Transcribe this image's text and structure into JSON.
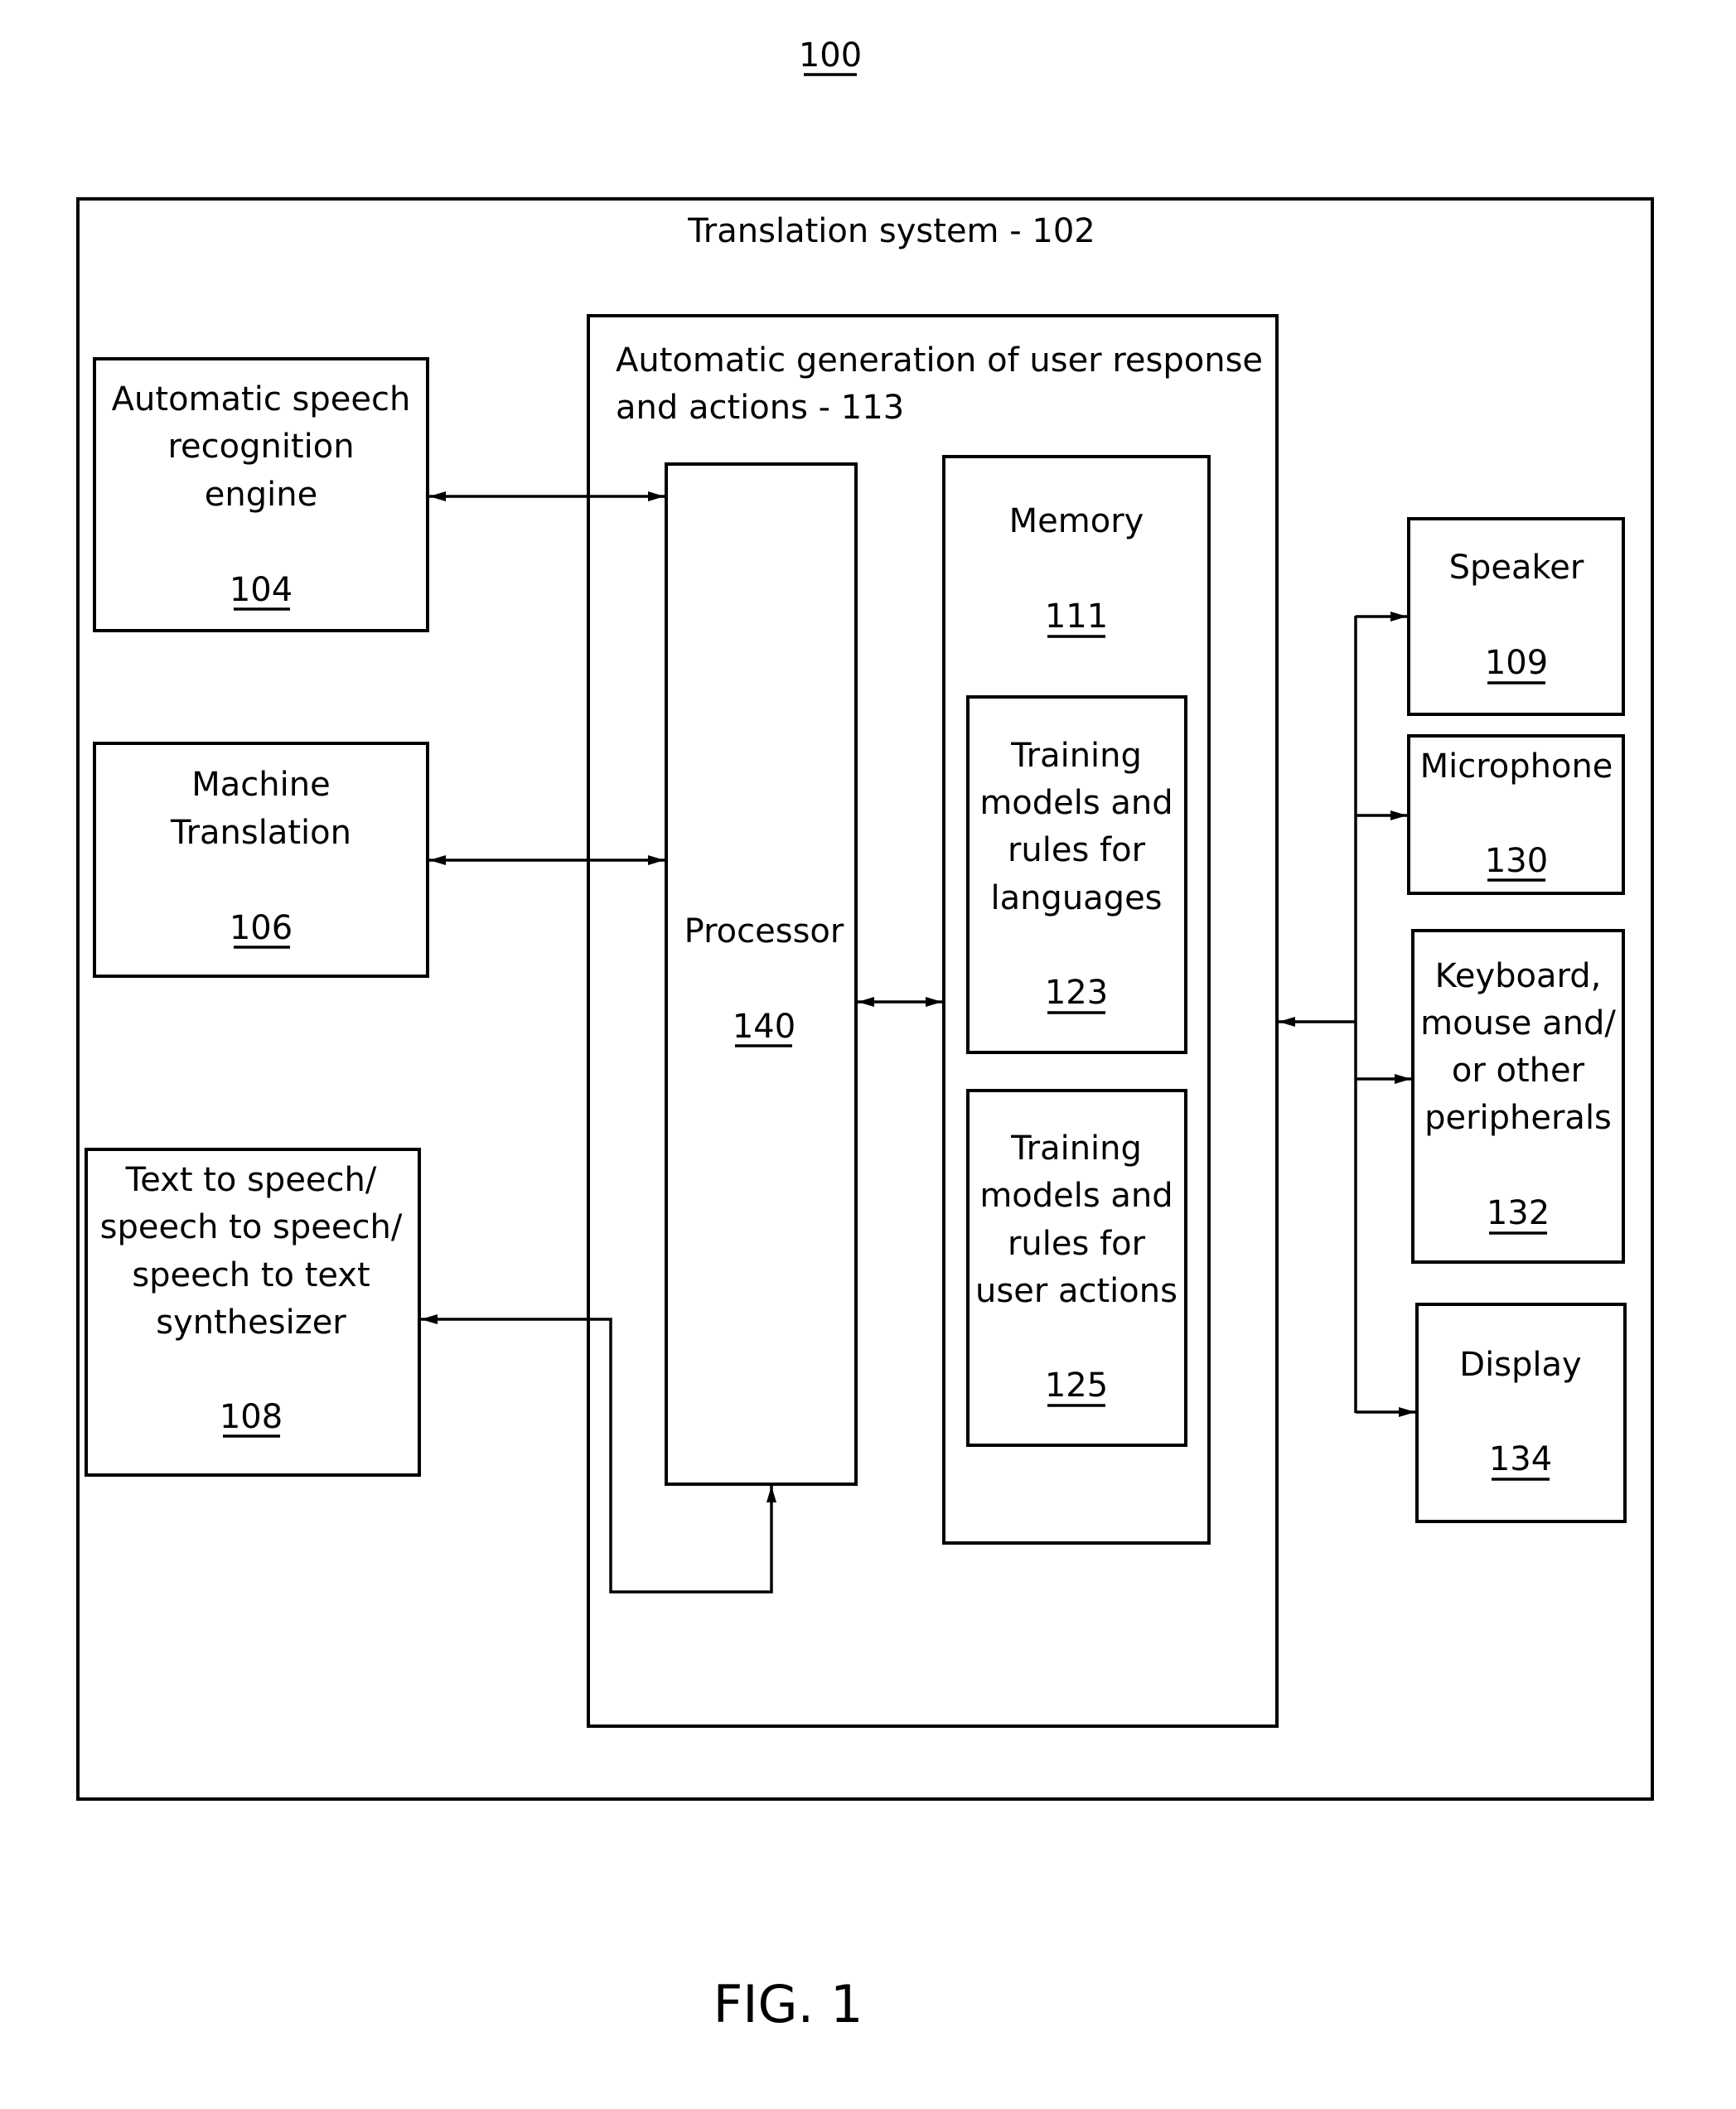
{
  "figure": {
    "reference": "100",
    "caption": "FIG. 1"
  },
  "system": {
    "title": "Translation system - 102"
  },
  "generator": {
    "title_line1": "Automatic generation of user response",
    "title_line2": "and actions  -  113"
  },
  "blocks": {
    "asr": {
      "lines": [
        "Automatic speech",
        "recognition",
        "engine"
      ],
      "ref": "104"
    },
    "mt": {
      "lines": [
        "Machine",
        "Translation"
      ],
      "ref": "106"
    },
    "tts": {
      "lines": [
        "Text to speech/",
        "speech to speech/",
        "speech to text",
        "synthesizer"
      ],
      "ref": "108"
    },
    "processor": {
      "lines": [
        "Processor"
      ],
      "ref": "140"
    },
    "memory": {
      "lines": [
        "Memory"
      ],
      "ref": "111"
    },
    "lang_models": {
      "lines": [
        "Training",
        "models and",
        "rules for",
        "languages"
      ],
      "ref": "123"
    },
    "action_models": {
      "lines": [
        "Training",
        "models and",
        "rules for",
        "user actions"
      ],
      "ref": "125"
    },
    "speaker": {
      "lines": [
        "Speaker"
      ],
      "ref": "109"
    },
    "microphone": {
      "lines": [
        "Microphone"
      ],
      "ref": "130"
    },
    "peripherals": {
      "lines": [
        "Keyboard,",
        "mouse and/",
        "or other",
        "peripherals"
      ],
      "ref": "132"
    },
    "display": {
      "lines": [
        "Display"
      ],
      "ref": "134"
    }
  },
  "connections": [
    {
      "from": "asr",
      "to": "processor",
      "direction": "bidirectional"
    },
    {
      "from": "mt",
      "to": "processor",
      "direction": "bidirectional"
    },
    {
      "from": "processor",
      "to": "memory",
      "direction": "bidirectional"
    },
    {
      "from": "processor",
      "to": "tts",
      "direction": "bidirectional"
    },
    {
      "from": "peripheral-bus",
      "to": "generator",
      "direction": "to"
    },
    {
      "from": "peripheral-bus",
      "to": "speaker",
      "direction": "to"
    },
    {
      "from": "peripheral-bus",
      "to": "microphone",
      "direction": "to"
    },
    {
      "from": "peripheral-bus",
      "to": "peripherals",
      "direction": "to"
    },
    {
      "from": "peripheral-bus",
      "to": "display",
      "direction": "to"
    }
  ]
}
